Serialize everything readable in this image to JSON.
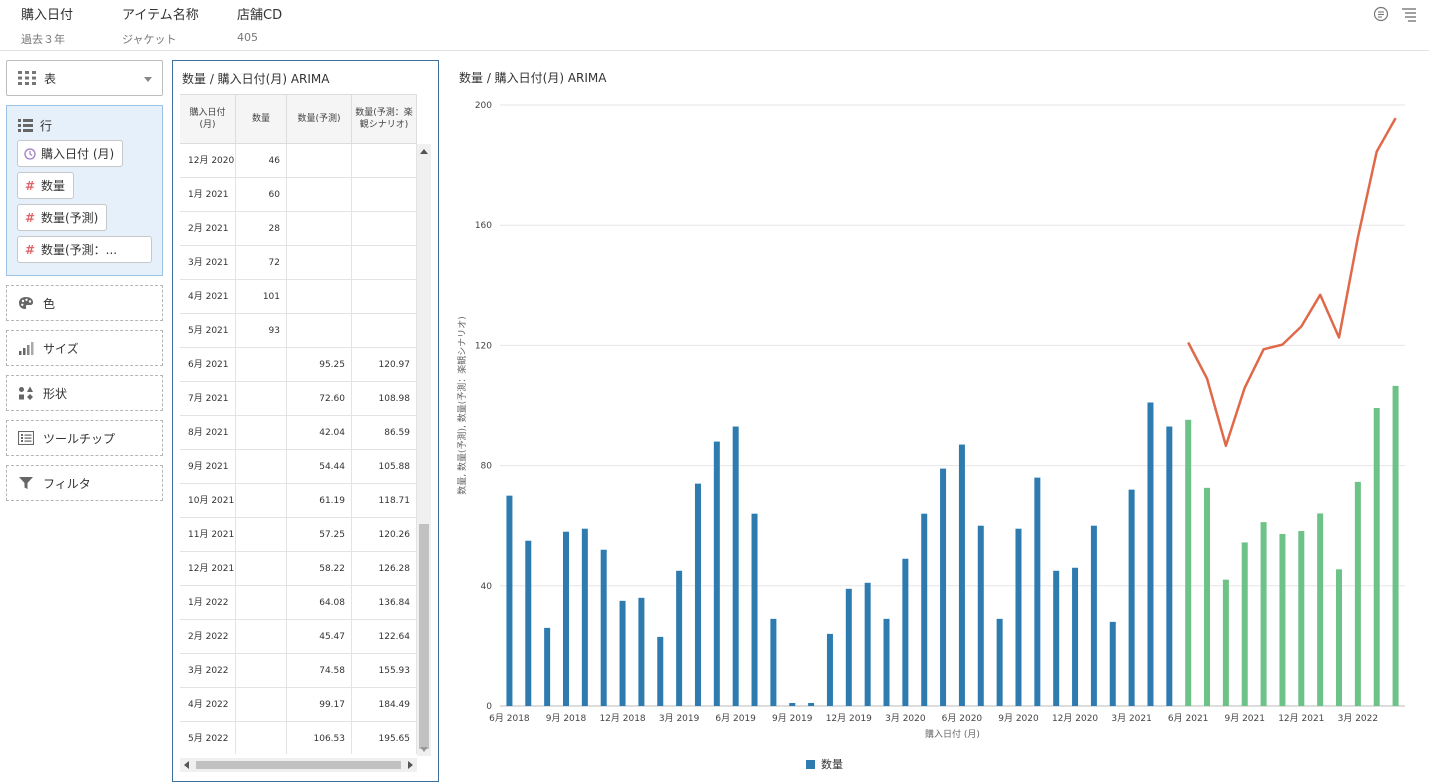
{
  "header": {
    "filters": [
      {
        "label": "購入日付",
        "value": "過去３年"
      },
      {
        "label": "アイテム名称",
        "value": "ジャケット"
      },
      {
        "label": "店舗CD",
        "value": "405"
      }
    ],
    "icons": [
      "comment-icon",
      "menu-icon"
    ]
  },
  "sidebar": {
    "viz_type": "表",
    "rows": {
      "title": "行",
      "items": [
        {
          "label": "購入日付 (月)",
          "icon": "clock-icon"
        },
        {
          "label": "数量",
          "icon": "hash-icon"
        },
        {
          "label": "数量(予測)",
          "icon": "hash-icon"
        },
        {
          "label": "数量(予測：...",
          "icon": "hash-icon"
        }
      ]
    },
    "slots": [
      {
        "label": "色",
        "icon": "palette-icon"
      },
      {
        "label": "サイズ",
        "icon": "size-icon"
      },
      {
        "label": "形状",
        "icon": "shape-icon"
      },
      {
        "label": "ツールチップ",
        "icon": "tooltip-icon"
      },
      {
        "label": "フィルタ",
        "icon": "filter-icon"
      }
    ]
  },
  "table": {
    "title": "数量 / 購入日付(月) ARIMA",
    "headers": [
      "購入日付 (月)",
      "数量",
      "数量(予測)",
      "数量(予測：楽観シナリオ)"
    ],
    "rows": [
      {
        "date": "12月 2020",
        "qty": "46",
        "forecast": "",
        "optimistic": ""
      },
      {
        "date": "1月 2021",
        "qty": "60",
        "forecast": "",
        "optimistic": ""
      },
      {
        "date": "2月 2021",
        "qty": "28",
        "forecast": "",
        "optimistic": ""
      },
      {
        "date": "3月 2021",
        "qty": "72",
        "forecast": "",
        "optimistic": ""
      },
      {
        "date": "4月 2021",
        "qty": "101",
        "forecast": "",
        "optimistic": ""
      },
      {
        "date": "5月 2021",
        "qty": "93",
        "forecast": "",
        "optimistic": ""
      },
      {
        "date": "6月 2021",
        "qty": "",
        "forecast": "95.25",
        "optimistic": "120.97"
      },
      {
        "date": "7月 2021",
        "qty": "",
        "forecast": "72.60",
        "optimistic": "108.98"
      },
      {
        "date": "8月 2021",
        "qty": "",
        "forecast": "42.04",
        "optimistic": "86.59"
      },
      {
        "date": "9月 2021",
        "qty": "",
        "forecast": "54.44",
        "optimistic": "105.88"
      },
      {
        "date": "10月 2021",
        "qty": "",
        "forecast": "61.19",
        "optimistic": "118.71"
      },
      {
        "date": "11月 2021",
        "qty": "",
        "forecast": "57.25",
        "optimistic": "120.26"
      },
      {
        "date": "12月 2021",
        "qty": "",
        "forecast": "58.22",
        "optimistic": "126.28"
      },
      {
        "date": "1月 2022",
        "qty": "",
        "forecast": "64.08",
        "optimistic": "136.84"
      },
      {
        "date": "2月 2022",
        "qty": "",
        "forecast": "45.47",
        "optimistic": "122.64"
      },
      {
        "date": "3月 2022",
        "qty": "",
        "forecast": "74.58",
        "optimistic": "155.93"
      },
      {
        "date": "4月 2022",
        "qty": "",
        "forecast": "99.17",
        "optimistic": "184.49"
      },
      {
        "date": "5月 2022",
        "qty": "",
        "forecast": "106.53",
        "optimistic": "195.65"
      }
    ]
  },
  "chart_data": {
    "type": "bar",
    "title": "数量 / 購入日付(月) ARIMA",
    "xlabel": "購入日付 (月)",
    "ylabel": "数量, 数量(予測), 数量(予測：楽観シナリオ)",
    "ylim": [
      0,
      200
    ],
    "yticks": [
      0,
      40,
      80,
      120,
      160,
      200
    ],
    "grid": true,
    "legend": "bottom",
    "legend_label": "数量",
    "colors": {
      "actual": "#2e7bb0",
      "forecast": "#6cc287",
      "optimistic": "#e0694a"
    },
    "x_start": "2018-06",
    "x_tick_labels": [
      "6月 2018",
      "9月 2018",
      "12月 2018",
      "3月 2019",
      "6月 2019",
      "9月 2019",
      "12月 2019",
      "3月 2020",
      "6月 2020",
      "9月 2020",
      "12月 2020",
      "3月 2021",
      "6月 2021",
      "9月 2021",
      "12月 2021",
      "3月 2022"
    ],
    "series": [
      {
        "name": "数量",
        "type": "bar",
        "values": [
          70,
          55,
          26,
          58,
          59,
          52,
          35,
          36,
          23,
          45,
          74,
          88,
          93,
          64,
          29,
          1,
          1,
          24,
          39,
          41,
          29,
          49,
          64,
          79,
          87,
          60,
          29,
          59,
          76,
          45,
          46,
          60,
          28,
          72,
          101,
          93,
          null,
          null,
          null,
          null,
          null,
          null,
          null,
          null,
          null,
          null,
          null,
          null
        ]
      },
      {
        "name": "数量(予測)",
        "type": "bar",
        "values": [
          null,
          null,
          null,
          null,
          null,
          null,
          null,
          null,
          null,
          null,
          null,
          null,
          null,
          null,
          null,
          null,
          null,
          null,
          null,
          null,
          null,
          null,
          null,
          null,
          null,
          null,
          null,
          null,
          null,
          null,
          null,
          null,
          null,
          null,
          null,
          null,
          95.25,
          72.6,
          42.04,
          54.44,
          61.19,
          57.25,
          58.22,
          64.08,
          45.47,
          74.58,
          99.17,
          106.53
        ]
      },
      {
        "name": "数量(予測：楽観シナリオ)",
        "type": "line",
        "values": [
          null,
          null,
          null,
          null,
          null,
          null,
          null,
          null,
          null,
          null,
          null,
          null,
          null,
          null,
          null,
          null,
          null,
          null,
          null,
          null,
          null,
          null,
          null,
          null,
          null,
          null,
          null,
          null,
          null,
          null,
          null,
          null,
          null,
          null,
          null,
          null,
          120.97,
          108.98,
          86.59,
          105.88,
          118.71,
          120.26,
          126.28,
          136.84,
          122.64,
          155.93,
          184.49,
          195.65
        ]
      }
    ]
  }
}
